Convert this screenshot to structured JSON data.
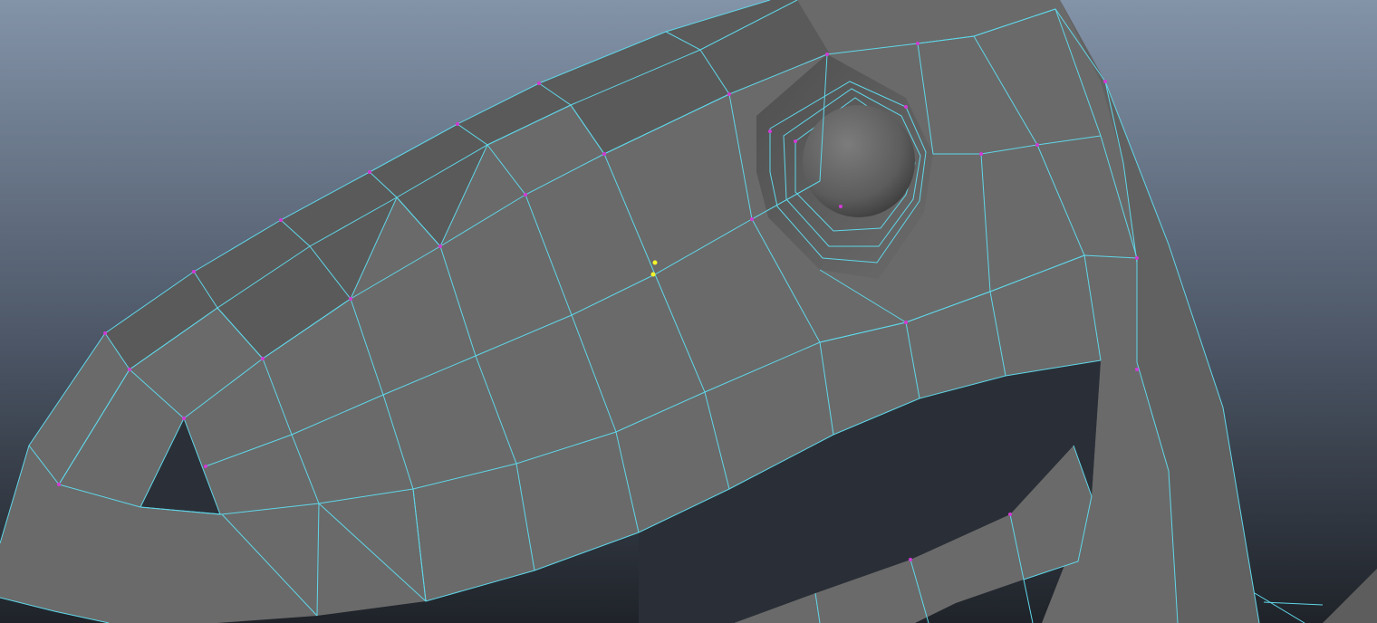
{
  "viewport": {
    "background_top": "#8393a8",
    "background_bottom": "#1f2329",
    "mesh_fill": "#6a6a6a",
    "wireframe_color": "#5fd6e8",
    "vertex_color": "#d23ad6",
    "selected_vertex_color": "#f4f42a"
  }
}
